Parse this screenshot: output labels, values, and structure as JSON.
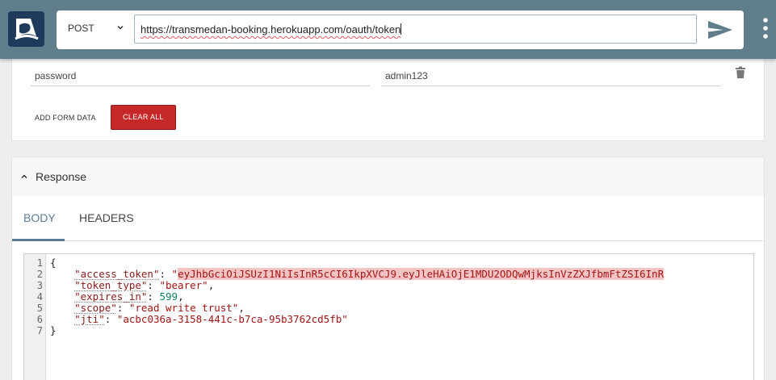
{
  "header": {
    "method": "POST",
    "url": "https://transmedan-booking.herokuapp.com/oauth/token"
  },
  "form_data": {
    "rows": [
      {
        "key": "password",
        "value": "admin123"
      }
    ],
    "add_label": "ADD FORM DATA",
    "clear_label": "CLEAR ALL"
  },
  "response": {
    "title": "Response",
    "tabs": [
      "BODY",
      "HEADERS"
    ],
    "active_tab": "BODY",
    "line_numbers": [
      "1",
      "2",
      "3",
      "4",
      "5",
      "6",
      "7"
    ],
    "body": {
      "open": "{",
      "access_token_key": "\"access_token\"",
      "access_token_value": "eyJhbGciOiJSUzI1NiIsInR5cCI6IkpXVCJ9.eyJleHAiOjE1MDU2ODQwMjksInVzZXJfbmFtZSI6InR",
      "token_type_key": "\"token_type\"",
      "token_type_value": "\"bearer\"",
      "expires_in_key": "\"expires_in\"",
      "expires_in_value": "599",
      "scope_key": "\"scope\"",
      "scope_value": "\"read write trust\"",
      "jti_key": "\"jti\"",
      "jti_value": "\"acbc036a-3158-441c-b7ca-95b3762cd5fb\"",
      "close": "}"
    }
  },
  "icons": {
    "logo": "app-logo-icon",
    "method_dropdown": "chevron-down-icon",
    "send": "send-icon",
    "menu": "more-vert-icon",
    "delete": "trash-icon",
    "collapse": "chevron-up-icon"
  },
  "colors": {
    "topbar": "#607d8b",
    "logo_bg": "#1f3a5a",
    "clear_button": "#c62828",
    "active_tab": "#5b7c93",
    "token_highlight": "#f2c4c4"
  }
}
